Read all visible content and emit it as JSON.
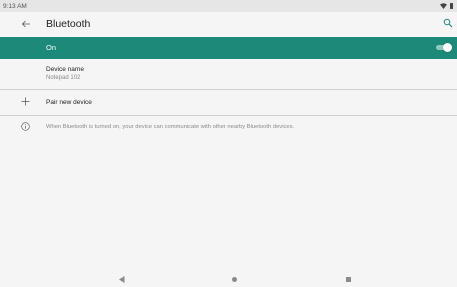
{
  "status_bar": {
    "time": "9:13 AM",
    "icons": [
      "wifi-icon",
      "battery-icon"
    ]
  },
  "app_bar": {
    "title": "Bluetooth",
    "back_icon": "arrow-left-icon",
    "search_icon": "search-icon"
  },
  "bluetooth_toggle": {
    "label": "On",
    "checked": true,
    "bar_color": "#1d8978"
  },
  "device_name": {
    "label": "Device name",
    "value": "Notepad 102"
  },
  "pair_new_device": {
    "label": "Pair new device",
    "icon": "plus-icon"
  },
  "info": {
    "icon": "info-icon",
    "text": "When Bluetooth is turned on, your device can communicate with other nearby Bluetooth devices."
  },
  "nav_bar": {
    "icons": [
      "back-triangle-icon",
      "home-circle-icon",
      "recents-square-icon"
    ]
  }
}
